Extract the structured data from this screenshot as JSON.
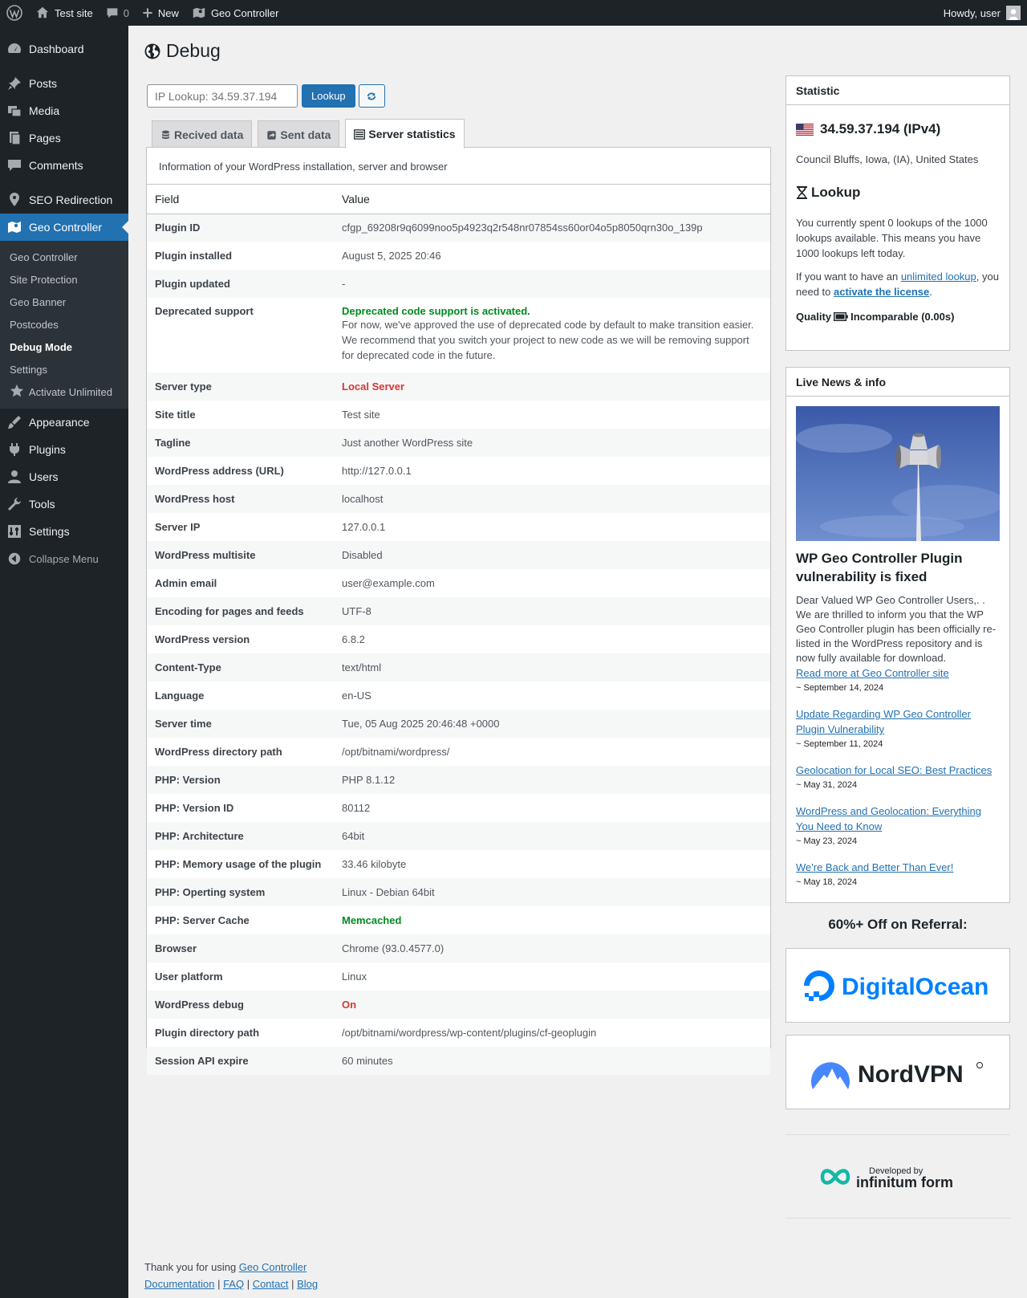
{
  "admin_bar": {
    "site_name": "Test site",
    "comments_count": "0",
    "new_label": "New",
    "plugin_label": "Geo Controller",
    "howdy": "Howdy, user"
  },
  "sidebar": {
    "items": [
      {
        "label": "Dashboard",
        "icon": "dashboard-icon"
      },
      {
        "label": "Posts",
        "icon": "pin-icon"
      },
      {
        "label": "Media",
        "icon": "media-icon"
      },
      {
        "label": "Pages",
        "icon": "pages-icon"
      },
      {
        "label": "Comments",
        "icon": "comment-icon"
      },
      {
        "label": "SEO Redirection",
        "icon": "location-icon"
      },
      {
        "label": "Geo Controller",
        "icon": "map-icon"
      },
      {
        "label": "Appearance",
        "icon": "brush-icon"
      },
      {
        "label": "Plugins",
        "icon": "plugin-icon"
      },
      {
        "label": "Users",
        "icon": "user-icon"
      },
      {
        "label": "Tools",
        "icon": "wrench-icon"
      },
      {
        "label": "Settings",
        "icon": "settings-icon"
      }
    ],
    "submenu": [
      "Geo Controller",
      "Site Protection",
      "Geo Banner",
      "Postcodes",
      "Debug Mode",
      "Settings",
      "Activate Unlimited"
    ],
    "collapse_label": "Collapse Menu"
  },
  "page": {
    "title": "Debug",
    "lookup_placeholder": "IP Lookup: 34.59.37.194",
    "lookup_button": "Lookup",
    "tabs": [
      "Recived data",
      "Sent data",
      "Server statistics"
    ],
    "intro": "Information of your WordPress installation, server and browser",
    "table_headers": {
      "field": "Field",
      "value": "Value"
    },
    "rows": [
      {
        "field": "Plugin ID",
        "value": "cfgp_69208r9q6099noo5p4923q2r548nr07854ss60or04o5p8050qrn30o_139p"
      },
      {
        "field": "Plugin installed",
        "value": "August 5, 2025 20:46"
      },
      {
        "field": "Plugin updated",
        "value": "-"
      },
      {
        "field": "Deprecated support",
        "value": "Deprecated code support is activated.",
        "note": "For now, we've approved the use of deprecated code by default to make transition easier. We recommend that you switch your project to new code as we will be removing support for deprecated code in the future."
      },
      {
        "field": "Server type",
        "value": "Local Server"
      },
      {
        "field": "Site title",
        "value": "Test site"
      },
      {
        "field": "Tagline",
        "value": "Just another WordPress site"
      },
      {
        "field": "WordPress address (URL)",
        "value": "http://127.0.0.1"
      },
      {
        "field": "WordPress host",
        "value": "localhost"
      },
      {
        "field": "Server IP",
        "value": "127.0.0.1"
      },
      {
        "field": "WordPress multisite",
        "value": "Disabled"
      },
      {
        "field": "Admin email",
        "value": "user@example.com"
      },
      {
        "field": "Encoding for pages and feeds",
        "value": "UTF-8"
      },
      {
        "field": "WordPress version",
        "value": "6.8.2"
      },
      {
        "field": "Content-Type",
        "value": "text/html"
      },
      {
        "field": "Language",
        "value": "en-US"
      },
      {
        "field": "Server time",
        "value": "Tue, 05 Aug 2025 20:46:48 +0000"
      },
      {
        "field": "WordPress directory path",
        "value": "/opt/bitnami/wordpress/"
      },
      {
        "field": "PHP: Version",
        "value": "PHP 8.1.12"
      },
      {
        "field": "PHP: Version ID",
        "value": "80112"
      },
      {
        "field": "PHP: Architecture",
        "value": "64bit"
      },
      {
        "field": "PHP: Memory usage of the plugin",
        "value": "33.46 kilobyte"
      },
      {
        "field": "PHP: Operting system",
        "value": "Linux - Debian 64bit"
      },
      {
        "field": "PHP: Server Cache",
        "value": "Memcached"
      },
      {
        "field": "Browser",
        "value": "Chrome (93.0.4577.0)"
      },
      {
        "field": "User platform",
        "value": "Linux"
      },
      {
        "field": "WordPress debug",
        "value": "On"
      },
      {
        "field": "Plugin directory path",
        "value": "/opt/bitnami/wordpress/wp-content/plugins/cf-geoplugin"
      },
      {
        "field": "Session API expire",
        "value": "60 minutes"
      }
    ]
  },
  "statistic": {
    "title": "Statistic",
    "ip": "34.59.37.194 (IPv4)",
    "location": "Council Bluffs, Iowa, (IA), United States",
    "lookup_heading": "Lookup",
    "lookup_text": "You currently spent 0 lookups of the 1000 lookups available. This means you have 1000 lookups left today.",
    "unlimited_pre": "If you want to have an ",
    "unlimited_link": "unlimited lookup",
    "unlimited_mid": ", you need to ",
    "license_link": "activate the license",
    "unlimited_post": ".",
    "quality_label": "Quality",
    "quality_value": "Incomparable (0.00s)"
  },
  "news": {
    "title": "Live News & info",
    "featured_title": "WP Geo Controller Plugin vulnerability is fixed",
    "featured_body": "Dear Valued WP Geo Controller Users,. . We are thrilled to inform you that the WP Geo Controller plugin has been officially re-listed in the WordPress repository and is now fully available for download.",
    "read_more": "Read more at Geo Controller site",
    "featured_date": "~ September 14, 2024",
    "items": [
      {
        "title": "Update Regarding WP Geo Controller Plugin Vulnerability",
        "date": "~ September 11, 2024"
      },
      {
        "title": "Geolocation for Local SEO: Best Practices",
        "date": "~ May 31, 2024"
      },
      {
        "title": "WordPress and Geolocation: Everything You Need to Know",
        "date": "~ May 23, 2024"
      },
      {
        "title": "We're Back and Better Than Ever!",
        "date": "~ May 18, 2024"
      }
    ]
  },
  "referral": {
    "title": "60%+ Off on Referral:",
    "brand1": "DigitalOcean",
    "brand2": "NordVPN",
    "dev_line1": "Developed by",
    "dev_line2": "infinitum form"
  },
  "footer": {
    "thanks": "Thank you for using ",
    "link": "Geo Controller",
    "links": [
      "Documentation",
      "FAQ",
      "Contact",
      "Blog"
    ],
    "sep": " | "
  },
  "colors": {
    "admin_dark": "#1d2327",
    "accent": "#2271b1",
    "green": "#008a20",
    "red": "#d63638",
    "digitalocean": "#0080ff",
    "nordvpn": "#4687ff",
    "infinitum": "#14b8a6"
  }
}
